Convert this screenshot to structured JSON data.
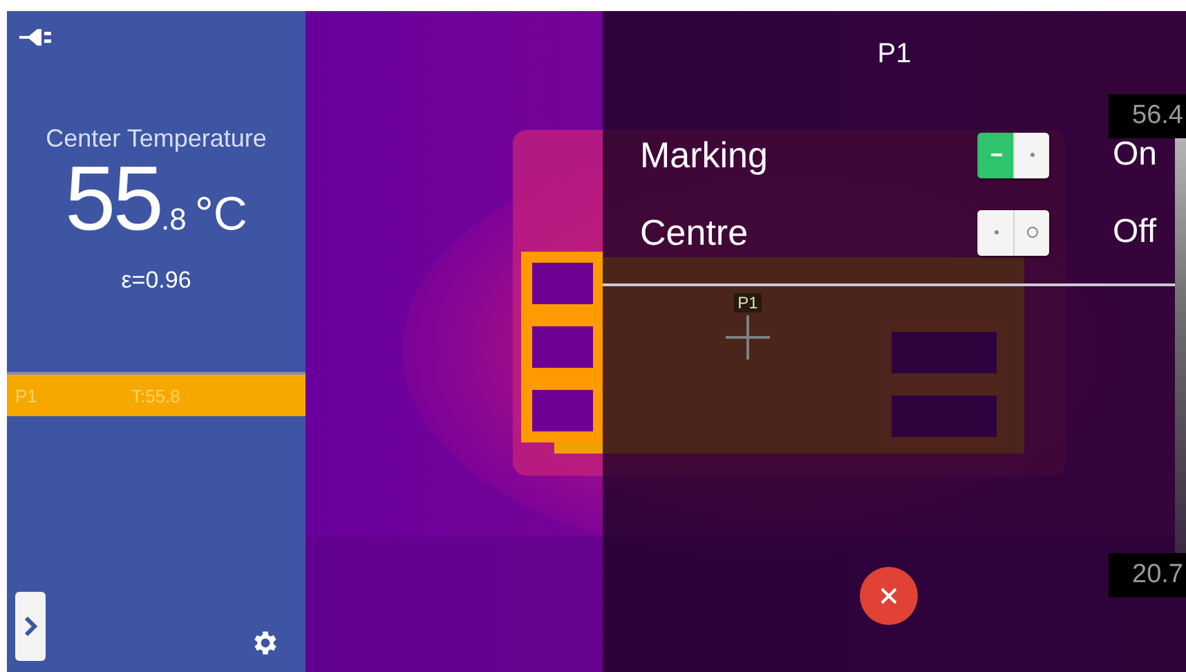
{
  "sidebar": {
    "title": "Center Temperature",
    "value_main": "55",
    "value_decimal": ".8",
    "unit": "°C",
    "emissivity": "ε=0.96",
    "points": [
      {
        "name": "P1",
        "reading": "T:55.8",
        "selected": true
      }
    ]
  },
  "scale": {
    "max": "56.4",
    "min": "20.7"
  },
  "marker": {
    "label": "P1"
  },
  "dialog": {
    "title": "P1",
    "settings": [
      {
        "label": "Marking",
        "on": true,
        "state_text": "On"
      },
      {
        "label": "Centre",
        "on": false,
        "state_text": "Off"
      }
    ]
  }
}
